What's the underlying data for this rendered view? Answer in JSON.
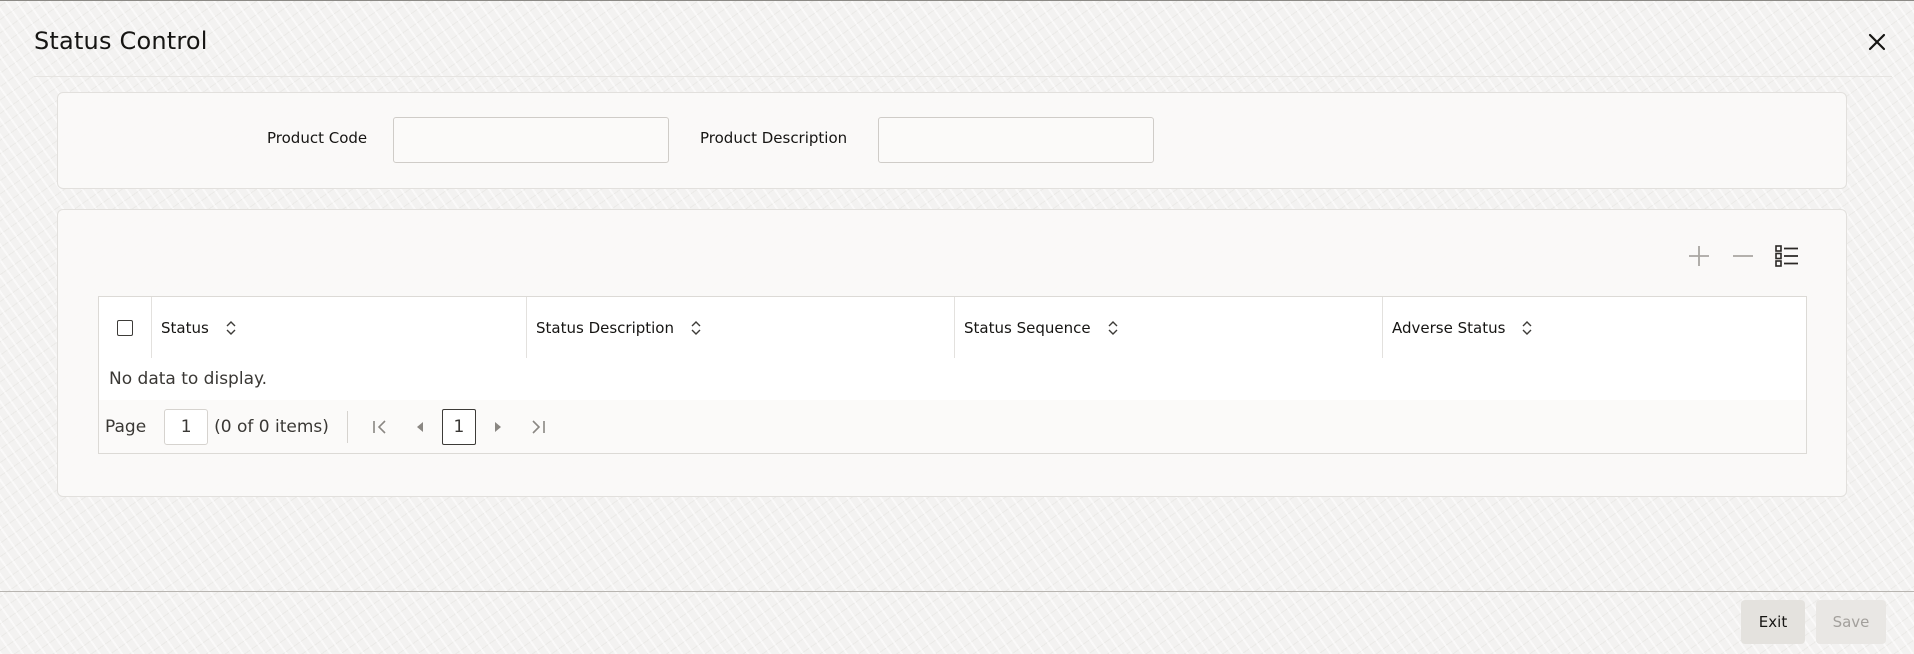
{
  "dialog": {
    "title": "Status Control"
  },
  "header_fields": {
    "product_code_label": "Product Code",
    "product_code_value": "",
    "product_description_label": "Product Description",
    "product_description_value": ""
  },
  "toolbar": {
    "icons": [
      "plus-icon",
      "minus-icon",
      "column-list-icon"
    ]
  },
  "table": {
    "columns": [
      "Status",
      "Status Description",
      "Status Sequence",
      "Adverse Status"
    ],
    "empty_message": "No data to display."
  },
  "pager": {
    "page_label": "Page",
    "page_value": "1",
    "items_text": "(0 of 0 items)",
    "current_page": "1"
  },
  "footer": {
    "exit_label": "Exit",
    "save_label": "Save"
  },
  "colors": {
    "text": "#161513",
    "disabled_text": "#a3a09c",
    "border": "#dcdad6"
  }
}
